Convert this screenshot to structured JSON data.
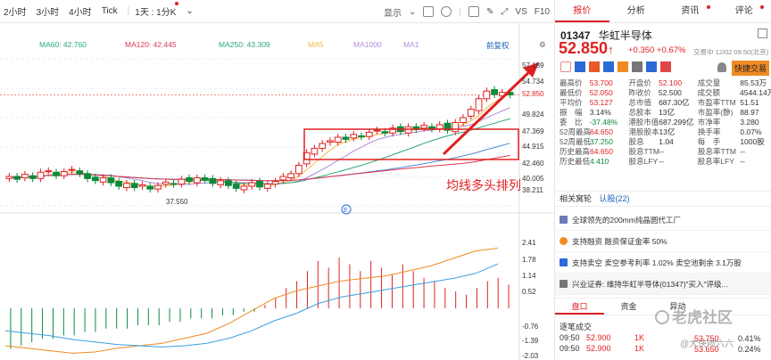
{
  "toolbar": {
    "items": [
      "2小时",
      "3小时",
      "4小时",
      "Tick",
      "1天 : 1分K"
    ],
    "right": [
      "显示",
      "VS",
      "F10"
    ]
  },
  "ma_legend": [
    {
      "label": "MA60: 42.760",
      "color": "#2aa77a"
    },
    {
      "label": "MA120: 42.445",
      "color": "#e0364f"
    },
    {
      "label": "MA250: 43.309",
      "color": "#2aa77a"
    },
    {
      "label": "MA5",
      "color": "#f0b840"
    },
    {
      "label": "MA1000",
      "color": "#b58ad8"
    },
    {
      "label": "MA1",
      "color": "#b58ad8"
    },
    {
      "label": "前复权",
      "color": "#1a5fb4"
    }
  ],
  "price_axis": [
    "57.189",
    "54.734",
    "52.850",
    "49.824",
    "47.369",
    "44.915",
    "42.460",
    "40.005",
    "38.211"
  ],
  "macd_axis": [
    "2.41",
    "1.78",
    "1.14",
    "0.52",
    "-0.76",
    "-1.39",
    "-2.03"
  ],
  "low_label": "37.550",
  "annotation": "均线多头排列",
  "chart_data": {
    "type": "candlestick",
    "ylim": [
      37,
      58
    ],
    "closes": [
      41.2,
      40.8,
      41.5,
      40.9,
      41.8,
      42.0,
      41.3,
      41.9,
      42.2,
      41.6,
      40.9,
      40.6,
      41.0,
      40.3,
      39.8,
      40.2,
      39.6,
      40.0,
      39.4,
      39.9,
      40.4,
      40.1,
      40.8,
      40.5,
      41.0,
      40.7,
      40.2,
      40.6,
      39.9,
      39.5,
      39.8,
      40.3,
      39.7,
      40.1,
      40.5,
      41.2,
      41.6,
      42.8,
      44.6,
      45.2,
      45.9,
      46.3,
      46.8,
      46.5,
      47.2,
      46.9,
      47.5,
      47.8,
      47.4,
      48.1,
      47.6,
      48.3,
      47.9,
      48.5,
      48.0,
      48.6,
      47.8,
      48.9,
      49.6,
      50.8,
      52.3,
      53.4,
      52.9,
      53.2,
      52.85
    ],
    "macd_hist": [
      -1.2,
      -1.1,
      -1.0,
      -0.9,
      -0.9,
      -0.8,
      -0.8,
      -0.7,
      -0.7,
      -0.6,
      -0.6,
      -0.6,
      -0.5,
      -0.5,
      -0.5,
      -0.4,
      -0.4,
      -0.3,
      -0.3,
      -0.3,
      -0.2,
      -0.2,
      -0.1,
      -0.1,
      0.1,
      0.3,
      0.6,
      0.8,
      1.1,
      1.4,
      1.2,
      1.5,
      1.3,
      1.1,
      1.4,
      1.2,
      1.0,
      1.3,
      1.1,
      0.9,
      0.8,
      0.6,
      0.5,
      0.4,
      0.6,
      0.8,
      0.9,
      0.7
    ],
    "dif": [
      -1.5,
      -1.6,
      -1.7,
      -1.8,
      -1.75,
      -1.6,
      -1.5,
      -1.4,
      -1.2,
      -1.0,
      -0.6,
      -0.1,
      0.4,
      0.7,
      0.9,
      1.1,
      1.2,
      1.3,
      1.5,
      1.7,
      2.0,
      2.3,
      2.41
    ],
    "dea": [
      -0.9,
      -1.0,
      -1.1,
      -1.25,
      -1.35,
      -1.45,
      -1.5,
      -1.55,
      -1.5,
      -1.4,
      -1.2,
      -0.9,
      -0.5,
      -0.2,
      0.2,
      0.45,
      0.6,
      0.75,
      0.9,
      1.05,
      1.2,
      1.4,
      1.78
    ]
  },
  "quote": {
    "code": "01347",
    "name": "华虹半导体",
    "price": "52.850",
    "arrow": "↑",
    "change": "+0.350",
    "pct": "+0.67%",
    "time": "交易中 12/02 09:50(北京)",
    "quick_trade": "快捷交易",
    "rows": [
      [
        [
          "最高价",
          "53.700",
          "red"
        ],
        [
          "开盘价",
          "52.100",
          "red"
        ],
        [
          "成交量",
          "85.53万",
          ""
        ]
      ],
      [
        [
          "最低价",
          "52.050",
          "red"
        ],
        [
          "昨收价",
          "52.500",
          ""
        ],
        [
          "成交额",
          "4544.14万",
          ""
        ]
      ],
      [
        [
          "平均价",
          "53.127",
          "red"
        ],
        [
          "总市值",
          "687.30亿",
          ""
        ],
        [
          "市盈率TTM",
          "51.51",
          ""
        ]
      ],
      [
        [
          "振　幅",
          "3.14%",
          ""
        ],
        [
          "总股本",
          "13亿",
          ""
        ],
        [
          "市盈率(静)",
          "88.97",
          ""
        ]
      ],
      [
        [
          "委　比",
          "-37.48%",
          "green"
        ],
        [
          "港股市值",
          "687.299亿",
          ""
        ],
        [
          "市净率",
          "3.280",
          ""
        ]
      ],
      [
        [
          "52周最高",
          "64.650",
          "red"
        ],
        [
          "港股股本",
          "13亿",
          ""
        ],
        [
          "换手率",
          "0.07%",
          ""
        ]
      ],
      [
        [
          "52周最低",
          "37.250",
          "green"
        ],
        [
          "股息",
          "1.04",
          ""
        ],
        [
          "每　手",
          "1000股",
          ""
        ]
      ],
      [
        [
          "历史最高",
          "64.650",
          "red"
        ],
        [
          "股息TTM",
          "--",
          ""
        ],
        [
          "股息率TTM",
          "--",
          ""
        ]
      ],
      [
        [
          "历史最低",
          "4.410",
          "green"
        ],
        [
          "股息LFY",
          "--",
          ""
        ],
        [
          "股息率LFY",
          "--",
          ""
        ]
      ]
    ],
    "related": "相关窝轮",
    "rating_label": "认股(22)",
    "news": [
      "全球领先的200mm纯晶圆代工厂",
      "支持融资 融资保证金率 50%",
      "支持卖空 卖空参考利率 1.02% 卖空池剩余 3.1万股",
      "兴业证券: 维持华虹半导体(01347)\"买入\"评级..."
    ],
    "bottom_tabs": [
      "盘口",
      "资金",
      "异动"
    ],
    "trades_title": "逐笔成交",
    "trades": [
      [
        "09:50",
        "52.900",
        "1K"
      ],
      [
        "09:50",
        "52.900",
        "1K"
      ]
    ],
    "right_trades": [
      "53.750",
      "53.650"
    ],
    "right_pct": [
      "0.41%",
      "0.24%"
    ],
    "watermark": "老虎社区",
    "watermark2": "@大侠吻六六"
  }
}
